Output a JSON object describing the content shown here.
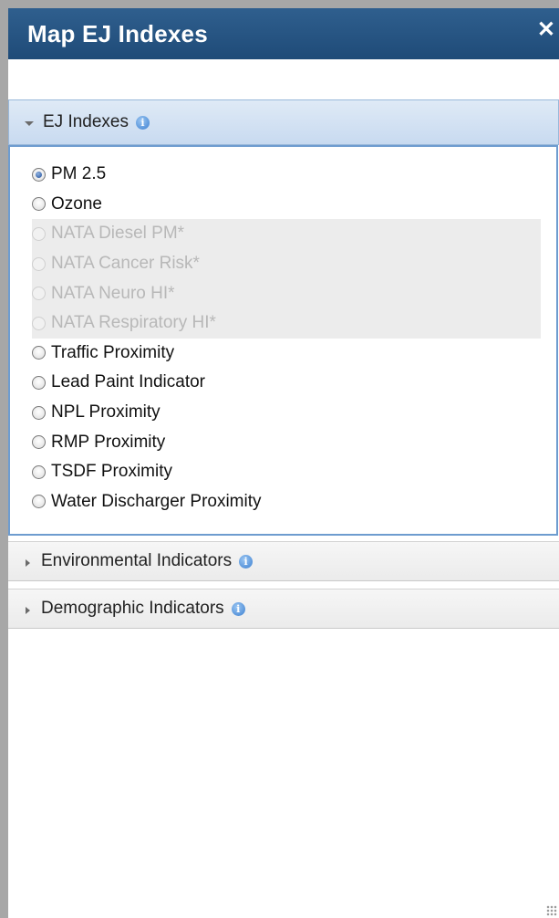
{
  "window": {
    "title": "Map EJ Indexes",
    "close_glyph": "✕"
  },
  "sections": [
    {
      "label": "EJ Indexes",
      "expanded": true,
      "options": [
        {
          "label": "PM 2.5",
          "checked": true,
          "disabled": false
        },
        {
          "label": "Ozone",
          "checked": false,
          "disabled": false
        },
        {
          "label": "NATA Diesel PM*",
          "checked": false,
          "disabled": true
        },
        {
          "label": "NATA Cancer Risk*",
          "checked": false,
          "disabled": true
        },
        {
          "label": "NATA Neuro HI*",
          "checked": false,
          "disabled": true
        },
        {
          "label": "NATA Respiratory HI*",
          "checked": false,
          "disabled": true
        },
        {
          "label": "Traffic Proximity",
          "checked": false,
          "disabled": false
        },
        {
          "label": "Lead Paint Indicator",
          "checked": false,
          "disabled": false
        },
        {
          "label": "NPL Proximity",
          "checked": false,
          "disabled": false
        },
        {
          "label": "RMP Proximity",
          "checked": false,
          "disabled": false
        },
        {
          "label": "TSDF Proximity",
          "checked": false,
          "disabled": false
        },
        {
          "label": "Water Discharger Proximity",
          "checked": false,
          "disabled": false
        }
      ]
    },
    {
      "label": "Environmental Indicators",
      "expanded": false
    },
    {
      "label": "Demographic Indicators",
      "expanded": false
    }
  ],
  "icons": {
    "info": "info-icon",
    "expand": "triangle-down",
    "collapsed": "triangle-right"
  },
  "colors": {
    "titlebar": "#1f4b78",
    "accent_border": "#6e9ccf",
    "disabled_text": "#b8b8b8"
  }
}
